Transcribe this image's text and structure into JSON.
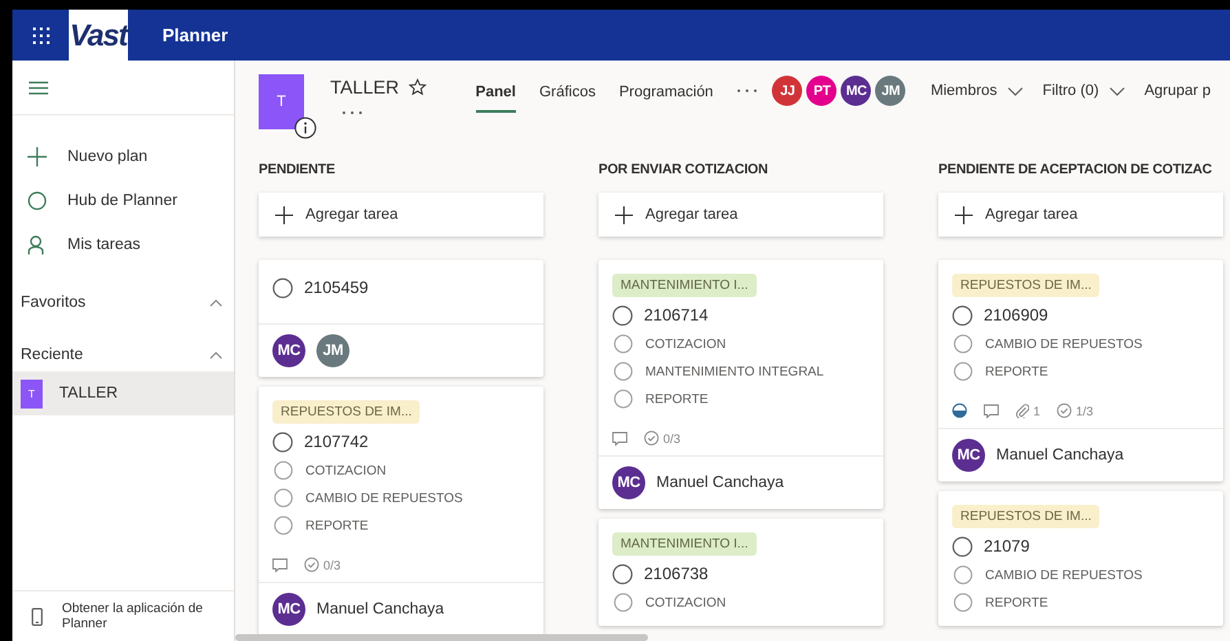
{
  "app": {
    "logo": "Vast",
    "name": "Planner"
  },
  "sidebar": {
    "items": [
      {
        "kind": "add",
        "label": "Nuevo plan"
      },
      {
        "kind": "hub",
        "label": "Hub de Planner"
      },
      {
        "kind": "person",
        "label": "Mis tareas"
      }
    ],
    "sections": [
      {
        "label": "Favoritos",
        "expanded": true
      },
      {
        "label": "Reciente",
        "expanded": true,
        "plans": [
          {
            "initial": "T",
            "name": "TALLER",
            "selected": true
          }
        ]
      }
    ],
    "footer": "Obtener la aplicación de Planner"
  },
  "plan": {
    "initial": "T",
    "name": "TALLER"
  },
  "tabs": [
    {
      "label": "Panel",
      "selected": true
    },
    {
      "label": "Gráficos",
      "selected": false
    },
    {
      "label": "Programación",
      "selected": false
    }
  ],
  "members": [
    {
      "initials": "JJ",
      "color": "#d13438"
    },
    {
      "initials": "PT",
      "color": "#e3008c"
    },
    {
      "initials": "MC",
      "color": "#5c2e91"
    },
    {
      "initials": "JM",
      "color": "#69797e"
    }
  ],
  "toolbar": [
    {
      "label": "Miembros",
      "kind": "dropdown"
    },
    {
      "label": "Filtro (0)",
      "kind": "dropdown"
    },
    {
      "label": "Agrupar p",
      "kind": "plain"
    }
  ],
  "buckets": [
    {
      "title": "PENDIENTE",
      "add_label": "Agregar tarea",
      "tasks": [
        {
          "title": "2105459",
          "assignees": [
            {
              "initials": "MC",
              "color": "#5c2e91"
            },
            {
              "initials": "JM",
              "color": "#69797e"
            }
          ]
        },
        {
          "label": {
            "text": "REPUESTOS DE IM...",
            "color": "#f9efcb"
          },
          "title": "2107742",
          "checklist": [
            {
              "text": "COTIZACION",
              "checked": false
            },
            {
              "text": "CAMBIO DE REPUESTOS",
              "checked": false
            },
            {
              "text": "REPORTE",
              "checked": false
            }
          ],
          "footer": {
            "comments": true,
            "checklist_count": "0/3"
          },
          "assignees": [
            {
              "initials": "MC",
              "color": "#5c2e91",
              "name": "Manuel Canchaya"
            }
          ]
        }
      ]
    },
    {
      "title": "POR ENVIAR COTIZACION",
      "add_label": "Agregar tarea",
      "tasks": [
        {
          "label": {
            "text": "MANTENIMIENTO I...",
            "color": "#dcedc8"
          },
          "title": "2106714",
          "checklist": [
            {
              "text": "COTIZACION",
              "checked": false
            },
            {
              "text": "MANTENIMIENTO INTEGRAL",
              "checked": false
            },
            {
              "text": "REPORTE",
              "checked": false
            }
          ],
          "footer": {
            "comments": true,
            "checklist_count": "0/3"
          },
          "assignees": [
            {
              "initials": "MC",
              "color": "#5c2e91",
              "name": "Manuel Canchaya"
            }
          ]
        },
        {
          "label": {
            "text": "MANTENIMIENTO I...",
            "color": "#dcedc8"
          },
          "title": "2106738",
          "checklist": [
            {
              "text": "COTIZACION",
              "checked": false
            }
          ]
        }
      ]
    },
    {
      "title": "PENDIENTE DE ACEPTACION DE COTIZAC",
      "add_label": "Agregar tarea",
      "tasks": [
        {
          "label": {
            "text": "REPUESTOS DE IM...",
            "color": "#f9efcb"
          },
          "title": "2106909",
          "checklist": [
            {
              "text": "CAMBIO DE REPUESTOS",
              "checked": false
            },
            {
              "text": "REPORTE",
              "checked": false
            }
          ],
          "footer": {
            "in_progress": true,
            "comments": true,
            "attachments": "1",
            "checklist_count": "1/3"
          },
          "assignees": [
            {
              "initials": "MC",
              "color": "#5c2e91",
              "name": "Manuel Canchaya"
            }
          ]
        },
        {
          "label": {
            "text": "REPUESTOS DE IM...",
            "color": "#f9efcb"
          },
          "title": "21079",
          "checklist": [
            {
              "text": "CAMBIO DE REPUESTOS",
              "checked": false
            },
            {
              "text": "REPORTE",
              "checked": false
            }
          ]
        }
      ]
    }
  ]
}
